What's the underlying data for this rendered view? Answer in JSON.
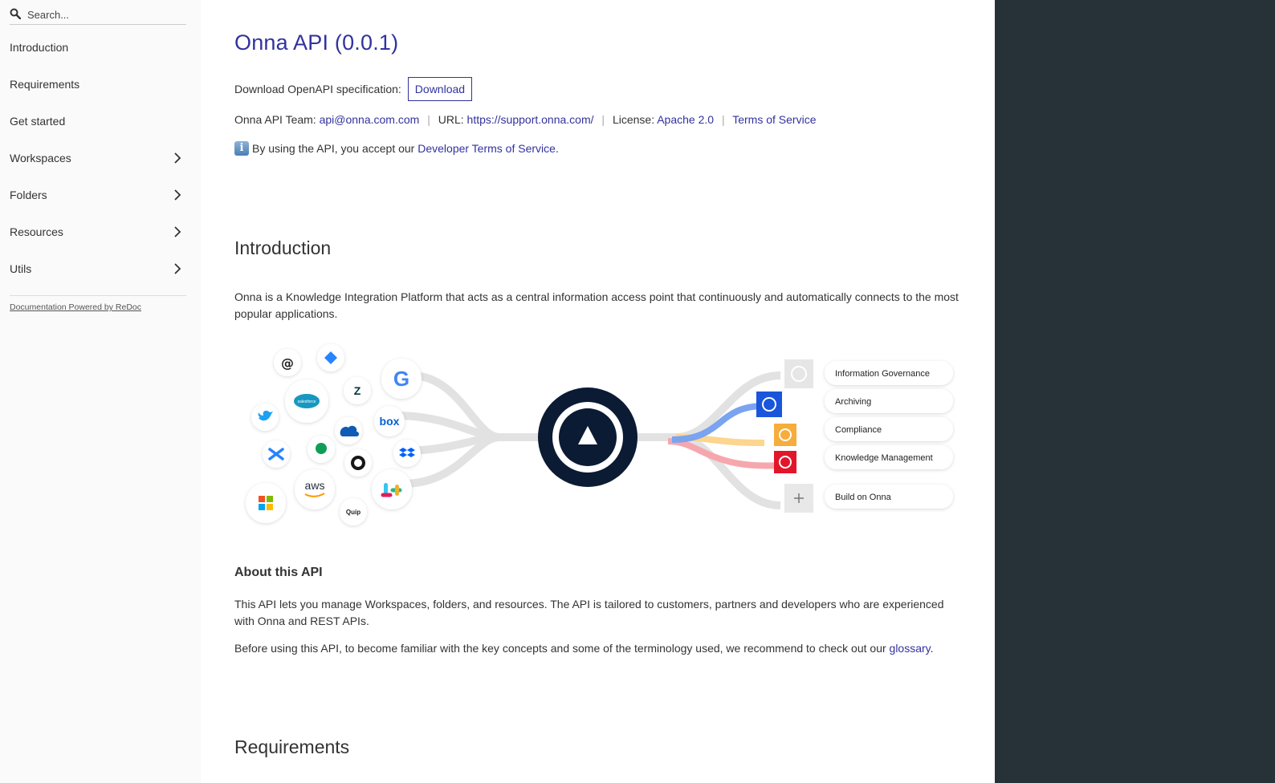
{
  "sidebar": {
    "search_placeholder": "Search...",
    "items": [
      {
        "label": "Introduction",
        "has_children": false
      },
      {
        "label": "Requirements",
        "has_children": false
      },
      {
        "label": "Get started",
        "has_children": false
      },
      {
        "label": "Workspaces",
        "has_children": true
      },
      {
        "label": "Folders",
        "has_children": true
      },
      {
        "label": "Resources",
        "has_children": true
      },
      {
        "label": "Utils",
        "has_children": true
      }
    ],
    "powered_by": "Documentation Powered by ReDoc"
  },
  "header": {
    "title": "Onna API (0.0.1)",
    "download_label": "Download OpenAPI specification:",
    "download_button": "Download",
    "team_label": "Onna API Team:",
    "team_email": "api@onna.com.com",
    "url_label": "URL:",
    "url_value": "https://support.onna.com/",
    "license_label": "License:",
    "license_value": "Apache 2.0",
    "terms_link": "Terms of Service",
    "dev_terms_prefix": "By using the API, you accept our",
    "dev_terms_link": "Developer Terms of Service",
    "dev_terms_suffix": "."
  },
  "intro": {
    "heading": "Introduction",
    "text": "Onna is a Knowledge Integration Platform that acts as a central information access point that continuously and automatically connects to the most popular applications."
  },
  "diagram": {
    "connector_icons": [
      "workplace-icon",
      "jira-icon",
      "google-icon",
      "salesforce-icon",
      "zendesk-icon",
      "twitter-icon",
      "box-icon",
      "onedrive-icon",
      "confluence-icon",
      "hangouts-icon",
      "dropbox-icon",
      "github-icon",
      "aws-icon",
      "slack-icon",
      "microsoft-icon",
      "quip-icon"
    ],
    "google_letter": "G",
    "salesforce_label": "salesforce",
    "box_label": "box",
    "aws_label": "aws",
    "quip_label": "Quip",
    "outputs": [
      "Information Governance",
      "Archiving",
      "Compliance",
      "Knowledge Management",
      "Build on Onna"
    ],
    "output_colors": [
      "#c8c8c8",
      "#1a56db",
      "#f6ad3b",
      "#e3152b",
      "#c8c8c8"
    ],
    "hub_color": "#0b1b33"
  },
  "about": {
    "heading": "About this API",
    "text1": "This API lets you manage Workspaces, folders, and resources. The API is tailored to customers, partners and developers who are experienced with Onna and REST APIs.",
    "text2_prefix": "Before using this API, to become familiar with the key concepts and some of the terminology used, we recommend to check out our",
    "text2_link": "glossary",
    "text2_suffix": "."
  },
  "requirements": {
    "heading": "Requirements"
  }
}
